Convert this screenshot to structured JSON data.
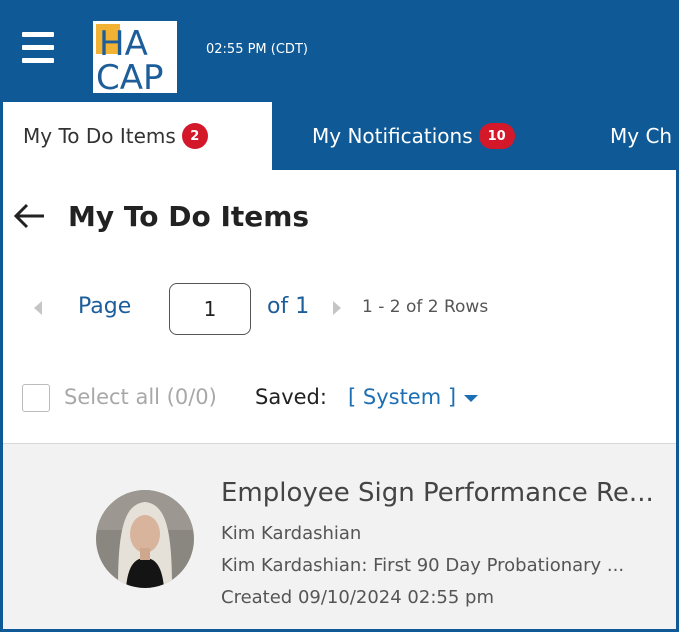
{
  "header": {
    "time": "02:55 PM (CDT)",
    "logo_text_top": "HA",
    "logo_text_bottom": "CAP",
    "brand_color": "#0f5a96"
  },
  "tabs": [
    {
      "label": "My To Do Items",
      "badge": "2",
      "active": true
    },
    {
      "label": "My Notifications",
      "badge": "10",
      "active": false
    },
    {
      "label": "My Ch",
      "badge": "",
      "active": false
    }
  ],
  "page": {
    "title": "My To Do Items"
  },
  "pager": {
    "page_label": "Page",
    "current_page": "1",
    "of_label": "of 1",
    "rows_label": "1 - 2 of 2 Rows"
  },
  "selection": {
    "select_all_label": "Select all (0/0)",
    "saved_label": "Saved:",
    "saved_value": "[ System ]"
  },
  "items": [
    {
      "title": "Employee Sign Performance Re...",
      "name": "Kim Kardashian",
      "description": "Kim Kardashian: First 90 Day Probationary ...",
      "created": "Created 09/10/2024 02:55 pm"
    }
  ],
  "icons": {
    "menu": "hamburger-menu-icon",
    "back": "back-arrow-icon",
    "prev": "prev-page-icon",
    "next": "next-page-icon",
    "dropdown": "chevron-down-icon"
  },
  "colors": {
    "header_bg": "#0f5a96",
    "badge_bg": "#d3182a",
    "link": "#1d5e9a",
    "list_bg": "#f2f2f2"
  }
}
